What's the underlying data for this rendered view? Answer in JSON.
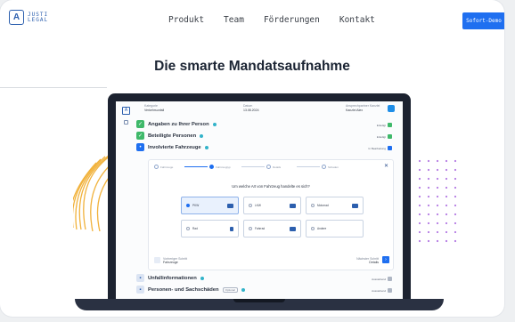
{
  "nav": {
    "logo_mark": "A",
    "logo_line1": "JUSTI",
    "logo_line2": "LEGAL",
    "items": [
      "Produkt",
      "Team",
      "Förderungen",
      "Kontakt"
    ],
    "cta": "Sofort-Demo"
  },
  "headline": "Die smarte Mandatsaufnahme",
  "colors": {
    "accent": "#1f6ff0",
    "green": "#3fb96a",
    "navy": "#1b2433",
    "stripe": "#f1b23c",
    "dots": "#b47be3"
  },
  "app": {
    "header": {
      "col1_label": "Kategorie",
      "col1_value": "Verkehrsunfall",
      "col2_label": "Datum",
      "col2_value": "13.08.2024",
      "col3_label": "Ansprechpartner Kanzlei",
      "col3_value": "Kanzlei Alex"
    },
    "sections": [
      {
        "title": "Angaben zu Ihrer Person",
        "status": "Erledigt",
        "status_color": "#3fb96a",
        "badge_color": "#3fb96a",
        "badge": "✓"
      },
      {
        "title": "Beteiligte Personen",
        "status": "Erledigt",
        "status_color": "#3fb96a",
        "badge_color": "#3fb96a",
        "badge": "✓"
      },
      {
        "title": "Involvierte Fahrzeuge",
        "status": "In Bearbeitung",
        "status_color": "#1f6ff0",
        "badge_color": "#1f6ff0",
        "badge": "•"
      }
    ],
    "wizard": {
      "steps": [
        "Fahrzeuge",
        "Fahrzeugtyp",
        "Details",
        "Schaden"
      ],
      "active_step": 1,
      "question": "Um welche Art von Fahrzeug handelte es sich?",
      "options": [
        "PKW",
        "LKW",
        "Motorrad",
        "Rad",
        "Fahrrad",
        "Andere"
      ],
      "selected_option": 0,
      "back_label": "Vorheriger Schritt",
      "back_value": "Fahrzeuge",
      "next_label": "Nächster Schritt",
      "next_value": "Details"
    },
    "lower_sections": [
      {
        "title": "Unfallinformationen",
        "status": "Ausstehend",
        "status_color": "#aeb6c4"
      },
      {
        "title": "Personen- und Sachschäden",
        "tag": "Optional",
        "status": "Ausstehend",
        "status_color": "#aeb6c4"
      }
    ]
  }
}
